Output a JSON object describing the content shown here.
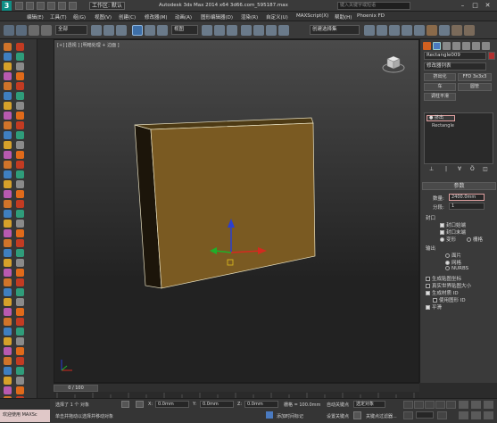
{
  "titlebar": {
    "workspace_label": "工作区: 默认",
    "title": "Autodesk 3ds Max  2014 x64     3d66.com_595187.max",
    "search_placeholder": "键入关键字或短语",
    "logo": "3"
  },
  "menu": [
    "编辑(E)",
    "工具(T)",
    "组(G)",
    "视图(V)",
    "创建(C)",
    "修改器(M)",
    "动画(A)",
    "图形编辑器(D)",
    "渲染(R)",
    "自定义(U)",
    "MAXScript(X)",
    "帮助(H)",
    "Phoenix FD"
  ],
  "toolbar": {
    "filter_value": "全部",
    "view_value": "视图",
    "selection_set_value": "创建选择集"
  },
  "viewport": {
    "label": "[+] [透视 ] [明暗处理 + 边面 ]"
  },
  "cmdpanel": {
    "object_name": "Rectangle009",
    "modifier_list": "修改器列表",
    "btn_extrude": "挤出化",
    "btn_ffd": "FFD 3x3x3",
    "btn_bend": "车",
    "btn_lathe": "圆管",
    "btn_shell": "调柱平滑",
    "stack_items": [
      "● 挤出",
      "Rectangle"
    ],
    "rollout_params": "参数",
    "amount_label": "数量:",
    "amount_value": "2400.0mm",
    "segments_label": "分段:",
    "segments_value": "1",
    "capping_label": "封口",
    "cap_start": "封口始端",
    "cap_end": "封口末端",
    "morph": "变形",
    "grid": "栅格",
    "output_label": "输出",
    "out_patch": "面片",
    "out_mesh": "网格",
    "out_nurbs": "NURBS",
    "gen_map_coords": "生成贴图坐标",
    "real_world_map": "真实世界贴图大小",
    "gen_mat_ids": "生成材质 ID",
    "use_shape_ids": "使用图形 ID",
    "smooth": "平滑"
  },
  "timeline": {
    "frame_label": "0 / 100"
  },
  "statusbar": {
    "maxscript": "欢迎使用 MAXSc",
    "selected_info": "选择了 1 个 对象",
    "prompt": "单击并拖动以选择并移动对象",
    "x_label": "X:",
    "x_value": "0.0mm",
    "y_label": "Y:",
    "y_value": "0.0mm",
    "z_label": "Z:",
    "z_value": "0.0mm",
    "grid_label": "栅格 = 100.0mm",
    "add_time_tag": "添加时间标记",
    "auto_key": "自动关键点",
    "selected_obj": "选定对象",
    "set_key": "设置关键点",
    "key_filters": "关键点过滤器..."
  }
}
